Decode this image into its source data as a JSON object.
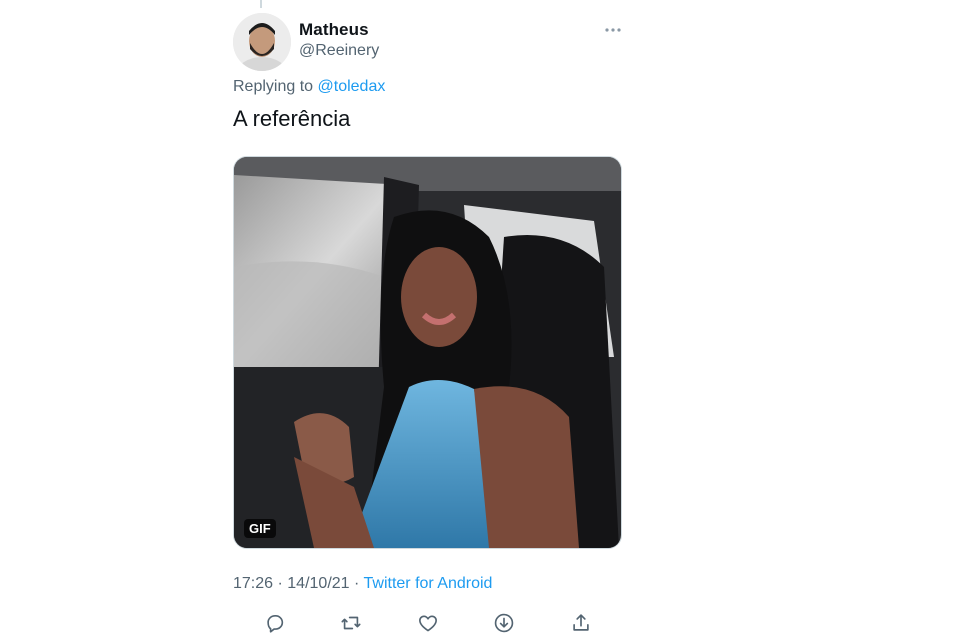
{
  "tweet": {
    "author": {
      "display_name": "Matheus",
      "handle": "@Reeinery"
    },
    "replying_prefix": "Replying to",
    "replying_to": "@toledax",
    "text": "A referência",
    "media": {
      "badge": "GIF"
    },
    "time": "17:26",
    "separator": "·",
    "date": "14/10/21",
    "source": "Twitter for Android"
  },
  "icons": {
    "more": "more-horizontal-icon",
    "reply": "reply-icon",
    "retweet": "retweet-icon",
    "like": "like-icon",
    "download": "download-icon",
    "share": "share-icon"
  },
  "colors": {
    "link": "#1d9bf0",
    "secondary_text": "#536471",
    "icon": "#536471"
  }
}
